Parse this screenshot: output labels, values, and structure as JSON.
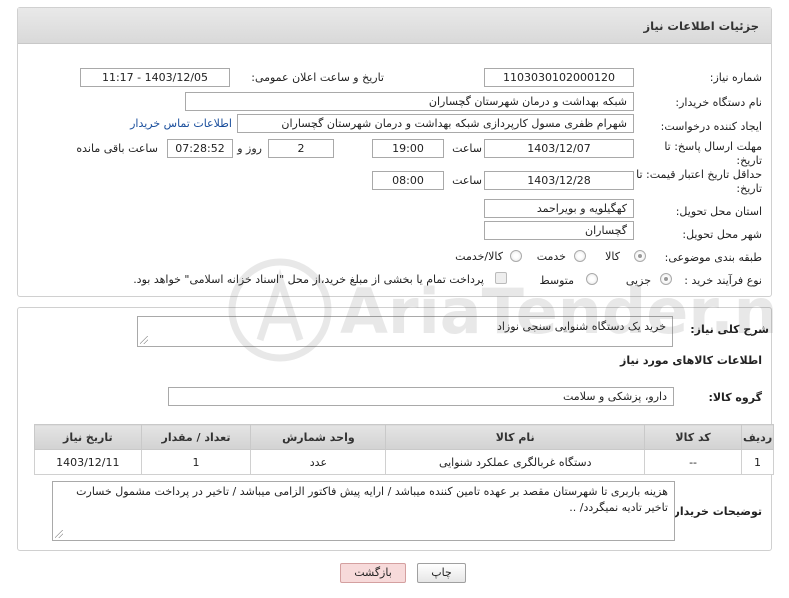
{
  "panel": {
    "title": "جزئیات اطلاعات نیاز"
  },
  "form": {
    "need_number_label": "شماره نیاز:",
    "need_number": "1103030102000120",
    "announce_label": "تاریخ و ساعت اعلان عمومی:",
    "announce_value": "1403/12/05 - 11:17",
    "buyer_org_label": "نام دستگاه خریدار:",
    "buyer_org": "شبکه بهداشت و درمان شهرستان گچساران",
    "creator_label": "ایجاد کننده درخواست:",
    "creator": "شهرام ظفری مسول کارپردازی  شبکه بهداشت و درمان شهرستان گچساران",
    "contact_link": "اطلاعات تماس خریدار",
    "deadline_label_1": "مهلت ارسال پاسخ: تا",
    "deadline_label_2": "تاریخ:",
    "deadline_date": "1403/12/07",
    "time_label": "ساعت",
    "deadline_time": "19:00",
    "days_value": "2",
    "days_label": "روز و",
    "remaining_time": "07:28:52",
    "remaining_label": "ساعت باقی مانده",
    "price_valid_label_1": "حداقل تاریخ اعتبار قیمت: تا",
    "price_valid_label_2": "تاریخ:",
    "price_valid_date": "1403/12/28",
    "price_valid_time": "08:00",
    "province_label": "استان محل تحویل:",
    "province": "کهگیلویه و بویراحمد",
    "city_label": "شهر محل تحویل:",
    "city": "گچساران",
    "category_label": "طبقه بندی موضوعی:",
    "category_options": [
      "کالا",
      "خدمت",
      "کالا/خدمت"
    ],
    "category_selected": "کالا",
    "process_label": "نوع فرآیند خرید :",
    "process_options": [
      "جزیی",
      "متوسط"
    ],
    "process_selected": "جزیی",
    "payment_note": "پرداخت تمام یا بخشی از مبلغ خرید،از محل \"اسناد خزانه اسلامی\" خواهد بود."
  },
  "description": {
    "label": "شرح کلی نیاز:",
    "value": "خرید یک دستگاه شنوایی سنجی نوزاد"
  },
  "goods": {
    "section_title": "اطلاعات کالاهای مورد نیاز",
    "group_label": "گروه کالا:",
    "group_value": "دارو، پزشکی و سلامت",
    "columns": [
      "ردیف",
      "کد کالا",
      "نام کالا",
      "واحد شمارش",
      "تعداد / مقدار",
      "تاریخ نیاز"
    ],
    "rows": [
      {
        "index": "1",
        "code": "--",
        "name": "دستگاه غربالگری عملکرد شنوایی",
        "unit": "عدد",
        "qty": "1",
        "date": "1403/12/11"
      }
    ]
  },
  "buyer_notes": {
    "label": "توضیحات خریدار:",
    "value": "هزینه باربری تا شهرستان مقصد بر عهده تامین کننده میباشد / ارایه پیش فاکتور الزامی  میباشد / تاخیر در پرداخت مشمول خسارت تاخیر تادیه نمیگردد/ .."
  },
  "buttons": {
    "print": "چاپ",
    "back": "بازگشت"
  },
  "watermark": {
    "text": "AriaTender.neT"
  },
  "colors": {
    "link": "#1a4e9c",
    "back_button_bg": "#f7dada",
    "header_bg": "#dedede"
  }
}
